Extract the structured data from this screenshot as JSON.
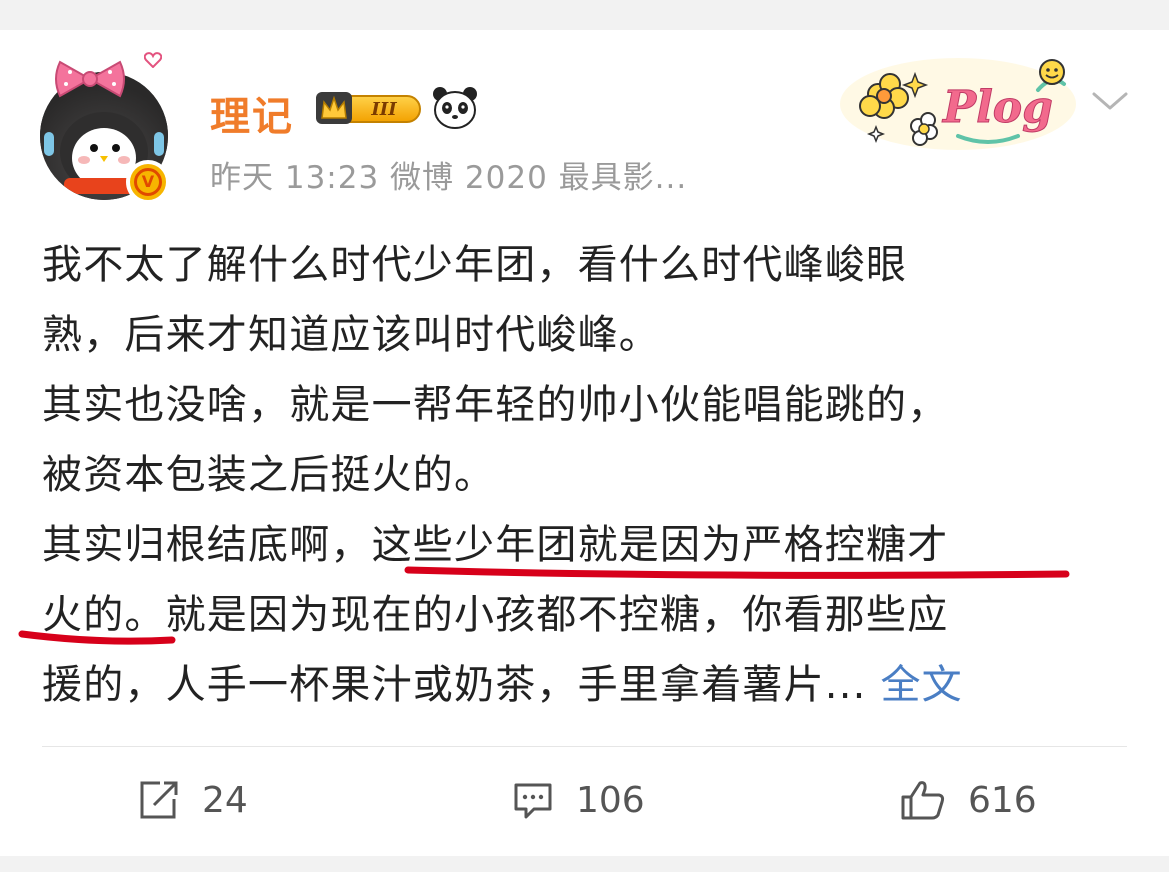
{
  "post": {
    "username": "理记",
    "member_level": "III",
    "verified_mark": "V",
    "meta": "昨天 13:23  微博 2020 最具影...",
    "decoration_text": "Plog",
    "body": {
      "line1": "我不太了解什么时代少年团，看什么时代峰峻眼",
      "line2": "熟，后来才知道应该叫时代峻峰。",
      "line3": "其实也没啥，就是一帮年轻的帅小伙能唱能跳的，",
      "line4": "被资本包装之后挺火的。",
      "line5_a": "其实归根结底啊，",
      "line5_b": "这些少年团就是因为严格控糖才",
      "line6_a": "火的。",
      "line6_b": "就是因为现在的小孩都不控糖，你看那些应",
      "line7": "援的，人手一杯果汁或奶茶，手里拿着薯片...",
      "full_text_link": "全文"
    }
  },
  "actions": {
    "repost_count": "24",
    "comment_count": "106",
    "like_count": "616"
  },
  "colors": {
    "username": "#f07c2a",
    "link": "#4a7ec4",
    "annotation_red": "#d7001a",
    "verified_bg": "#f7b500"
  },
  "icons": {
    "avatar": "penguin-avatar",
    "member_badge": "crown-badge-icon",
    "panda": "panda-icon",
    "more": "chevron-down-icon",
    "repost": "repost-icon",
    "comment": "comment-icon",
    "like": "thumbs-up-icon"
  }
}
